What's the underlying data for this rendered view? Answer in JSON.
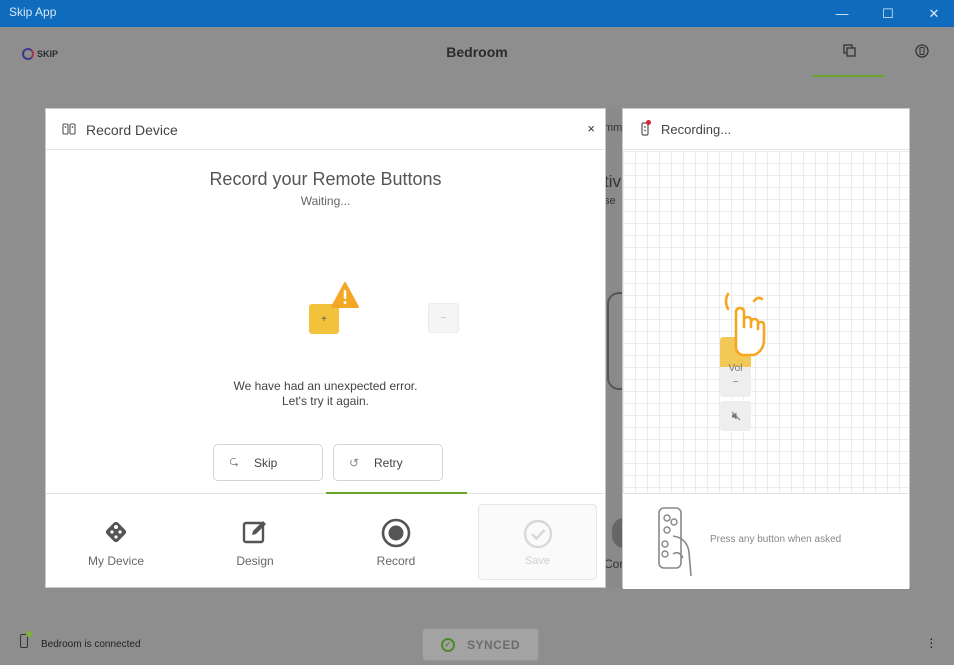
{
  "window": {
    "title": "Skip App",
    "minimize": "—",
    "maximize": "☐",
    "close": "✕"
  },
  "header": {
    "logo_text": "SKIP",
    "room_title": "Bedroom"
  },
  "background_peek": {
    "text_top": "mm",
    "text_big": "tiv",
    "text_small": "se",
    "text_bottom": "Cor"
  },
  "dialog": {
    "title": "Record Device",
    "close_symbol": "×",
    "heading": "Record your Remote Buttons",
    "status": "Waiting...",
    "plus_key": "+",
    "minus_key": "−",
    "error_line1": "We have had an unexpected error.",
    "error_line2": "Let's try it again.",
    "skip_label": "Skip",
    "retry_label": "Retry",
    "tabs": [
      {
        "label": "My Device",
        "icon": "remote-diamond-icon"
      },
      {
        "label": "Design",
        "icon": "edit-icon"
      },
      {
        "label": "Record",
        "icon": "record-icon"
      },
      {
        "label": "Save",
        "icon": "check-circle-icon"
      }
    ]
  },
  "recording": {
    "title": "Recording...",
    "vol_label": "Vol",
    "vol_minus": "−",
    "mute_symbol": "🔇",
    "prompt": "Press any button when asked"
  },
  "statusbar": {
    "connection": "Bedroom is connected",
    "sync_label": "SYNCED"
  },
  "colors": {
    "accent_green": "#6aa32a",
    "key_yellow": "#f2c23c",
    "titlebar_blue": "#0f6cbd",
    "warning_orange": "#f5a623",
    "record_red": "#d9252d"
  }
}
